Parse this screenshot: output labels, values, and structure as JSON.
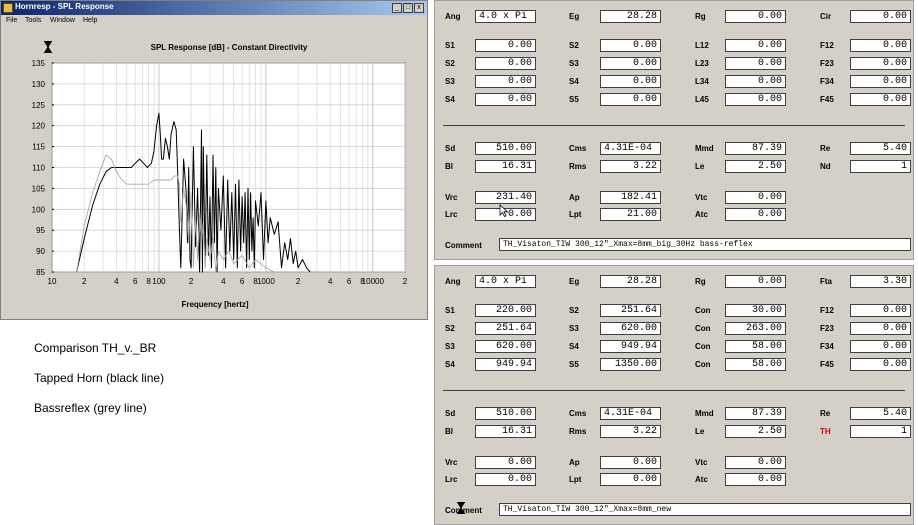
{
  "window": {
    "title": "Hornresp - SPL Response",
    "menu": [
      "File",
      "Tools",
      "Window",
      "Help"
    ],
    "controls": {
      "minimize": "_",
      "maximize": "□",
      "close": "x"
    }
  },
  "chart_data": {
    "type": "line",
    "title": "SPL Response [dB] - Constant Directivity",
    "xlabel": "Frequency [hertz]",
    "ylabel": "",
    "xscale": "log",
    "xlim": [
      10,
      20000
    ],
    "ylim": [
      85,
      135
    ],
    "yticks": [
      85,
      90,
      95,
      100,
      105,
      110,
      115,
      120,
      125,
      130,
      135
    ],
    "xtick_labels": [
      {
        "f": 10,
        "label": "10"
      },
      {
        "f": 20,
        "label": "2"
      },
      {
        "f": 40,
        "label": "4"
      },
      {
        "f": 60,
        "label": "6"
      },
      {
        "f": 80,
        "label": "8"
      },
      {
        "f": 100,
        "label": "100"
      },
      {
        "f": 200,
        "label": "2"
      },
      {
        "f": 400,
        "label": "4"
      },
      {
        "f": 600,
        "label": "6"
      },
      {
        "f": 800,
        "label": "8"
      },
      {
        "f": 1000,
        "label": "1000"
      },
      {
        "f": 2000,
        "label": "2"
      },
      {
        "f": 4000,
        "label": "4"
      },
      {
        "f": 6000,
        "label": "6"
      },
      {
        "f": 8000,
        "label": "8"
      },
      {
        "f": 10000,
        "label": "10000"
      },
      {
        "f": 20000,
        "label": "2"
      }
    ],
    "grid": true,
    "series": [
      {
        "color": "#000000",
        "x": [
          17,
          20,
          24,
          28,
          32,
          36,
          40,
          45,
          50,
          55,
          60,
          66,
          72,
          78,
          85,
          90,
          95,
          100,
          103,
          106,
          110,
          115,
          120,
          125,
          130,
          138,
          145,
          150,
          155,
          160,
          170,
          180,
          185,
          190,
          195,
          200,
          210,
          220,
          230,
          240,
          250,
          255,
          260,
          270,
          280,
          290,
          300,
          310,
          320,
          330,
          340,
          350,
          360,
          380,
          400,
          420,
          440,
          460,
          480,
          500,
          520,
          540,
          560,
          580,
          600,
          620,
          640,
          660,
          680,
          700,
          720,
          740,
          760,
          780,
          800,
          850,
          900,
          950,
          1000,
          1050,
          1100,
          1200,
          1300,
          1400,
          1500,
          1600,
          1700,
          1800,
          1900,
          2000,
          2200,
          2400,
          2600
        ],
        "y": [
          85,
          93,
          101,
          106,
          109,
          110,
          110,
          110,
          110,
          110,
          111,
          112,
          111,
          110,
          111,
          114,
          120,
          123,
          118,
          112,
          112,
          117,
          115,
          112,
          118,
          121,
          119,
          108,
          96,
          86,
          112,
          104,
          92,
          110,
          88,
          86,
          115,
          91,
          105,
          85,
          119,
          85,
          115,
          88,
          113,
          89,
          103,
          86,
          113,
          92,
          110,
          85,
          105,
          95,
          108,
          86,
          107,
          90,
          104,
          88,
          106,
          86,
          107,
          90,
          103,
          92,
          104,
          86,
          105,
          88,
          104,
          90,
          98,
          86,
          102,
          96,
          104,
          88,
          102,
          92,
          98,
          94,
          97,
          86,
          92,
          88,
          93,
          87,
          90,
          86,
          88,
          86,
          85
        ]
      },
      {
        "color": "#aaaaaa",
        "x": [
          17,
          20,
          24,
          28,
          32,
          36,
          40,
          45,
          50,
          60,
          70,
          80,
          90,
          100,
          110,
          120,
          130,
          140,
          150,
          155,
          160,
          170,
          180,
          190,
          200,
          210,
          220,
          230,
          240,
          250,
          260,
          270,
          280,
          300,
          320,
          340,
          360,
          400,
          450,
          500,
          600,
          700,
          800,
          1000,
          1200
        ],
        "y": [
          85,
          96,
          104,
          109,
          113,
          112,
          109,
          107,
          106,
          106,
          106,
          106,
          107,
          107,
          107,
          107,
          107,
          108,
          108,
          106,
          97,
          105,
          101,
          92,
          104,
          86,
          98,
          88,
          99,
          92,
          97,
          86,
          93,
          88,
          93,
          85,
          90,
          88,
          90,
          87,
          89,
          86,
          88,
          86,
          85
        ]
      }
    ]
  },
  "notes": [
    "Comparison TH_v._BR",
    "Tapped Horn (black line)",
    "Bassreflex (grey line)"
  ],
  "panel1": {
    "row1": [
      [
        "Ang",
        "4.0 x Pi"
      ],
      [
        "Eg",
        "28.28"
      ],
      [
        "Rg",
        "0.00"
      ],
      [
        "Cir",
        "0.00"
      ]
    ],
    "grid": [
      [
        [
          "S1",
          "0.00"
        ],
        [
          "S2",
          "0.00"
        ],
        [
          "L12",
          "0.00"
        ],
        [
          "F12",
          "0.00"
        ]
      ],
      [
        [
          "S2",
          "0.00"
        ],
        [
          "S3",
          "0.00"
        ],
        [
          "L23",
          "0.00"
        ],
        [
          "F23",
          "0.00"
        ]
      ],
      [
        [
          "S3",
          "0.00"
        ],
        [
          "S4",
          "0.00"
        ],
        [
          "L34",
          "0.00"
        ],
        [
          "F34",
          "0.00"
        ]
      ],
      [
        [
          "S4",
          "0.00"
        ],
        [
          "S5",
          "0.00"
        ],
        [
          "L45",
          "0.00"
        ],
        [
          "F45",
          "0.00"
        ]
      ]
    ],
    "drv1": [
      [
        "Sd",
        "510.00"
      ],
      [
        "Cms",
        "4.31E-04"
      ],
      [
        "Mmd",
        "87.39"
      ],
      [
        "Re",
        "5.40"
      ]
    ],
    "drv2": [
      [
        "Bl",
        "16.31"
      ],
      [
        "Rms",
        "3.22"
      ],
      [
        "Le",
        "2.50"
      ],
      [
        "Nd",
        "1"
      ]
    ],
    "enc1": [
      [
        "Vrc",
        "231.40"
      ],
      [
        "Ap",
        "182.41"
      ],
      [
        "Vtc",
        "0.00"
      ]
    ],
    "enc2": [
      [
        "Lrc",
        "0.00"
      ],
      [
        "Lpt",
        "21.00"
      ],
      [
        "Atc",
        "0.00"
      ]
    ],
    "comment_label": "Comment",
    "comment": "TH_Visaton_TIW 300_12\"_Xmax=8mm_big_30Hz bass-reflex"
  },
  "panel2": {
    "row1": [
      [
        "Ang",
        "4.0 x Pi"
      ],
      [
        "Eg",
        "28.28"
      ],
      [
        "Rg",
        "0.00"
      ],
      [
        "Fta",
        "3.30"
      ]
    ],
    "grid": [
      [
        [
          "S1",
          "220.00"
        ],
        [
          "S2",
          "251.64"
        ],
        [
          "Con",
          "30.00"
        ],
        [
          "F12",
          "0.00"
        ]
      ],
      [
        [
          "S2",
          "251.64"
        ],
        [
          "S3",
          "620.00"
        ],
        [
          "Con",
          "263.00"
        ],
        [
          "F23",
          "0.00"
        ]
      ],
      [
        [
          "S3",
          "620.00"
        ],
        [
          "S4",
          "949.94"
        ],
        [
          "Con",
          "58.00"
        ],
        [
          "F34",
          "0.00"
        ]
      ],
      [
        [
          "S4",
          "949.94"
        ],
        [
          "S5",
          "1350.00"
        ],
        [
          "Con",
          "58.00"
        ],
        [
          "F45",
          "0.00"
        ]
      ]
    ],
    "drv1": [
      [
        "Sd",
        "510.00"
      ],
      [
        "Cms",
        "4.31E-04"
      ],
      [
        "Mmd",
        "87.39"
      ],
      [
        "Re",
        "5.40"
      ]
    ],
    "drv2": [
      [
        "Bl",
        "16.31"
      ],
      [
        "Rms",
        "3.22"
      ],
      [
        "Le",
        "2.50"
      ],
      [
        "TH",
        "1"
      ]
    ],
    "enc1": [
      [
        "Vrc",
        "0.00"
      ],
      [
        "Ap",
        "0.00"
      ],
      [
        "Vtc",
        "0.00"
      ]
    ],
    "enc2": [
      [
        "Lrc",
        "0.00"
      ],
      [
        "Lpt",
        "0.00"
      ],
      [
        "Atc",
        "0.00"
      ]
    ],
    "comment_label": "Comment",
    "comment": "TH_Visaton_TIW 300_12\"_Xmax=8mm_new"
  },
  "colors": {
    "chrome": "#d4d0c8",
    "title_bar": "#0a246a",
    "highlight_label": "#e00000"
  },
  "icons": [
    "hourglass-icon",
    "mouse-cursor-icon",
    "app-icon"
  ]
}
